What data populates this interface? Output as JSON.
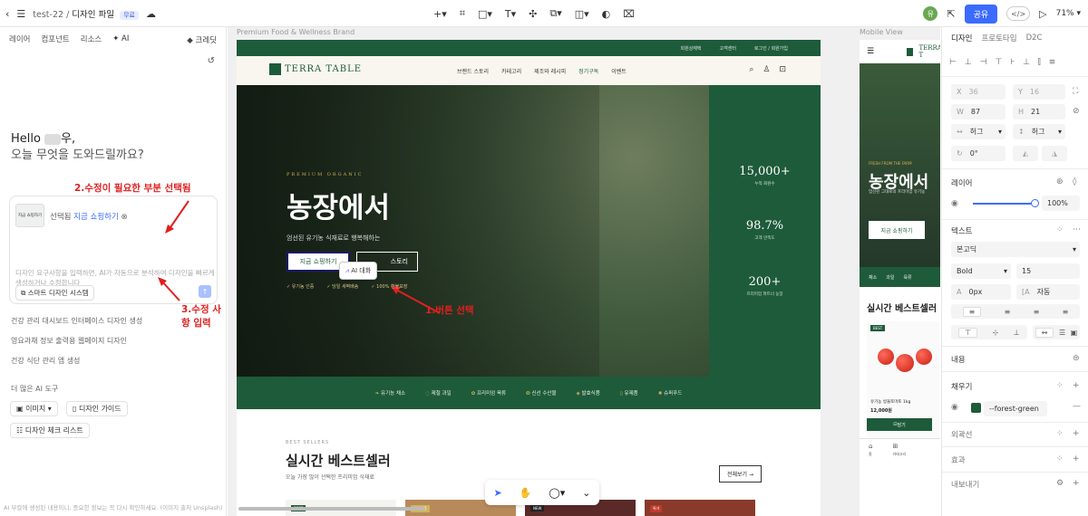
{
  "topbar": {
    "project": "test-22",
    "file": "디자인 파일",
    "badge": "무료",
    "share_label": "공유",
    "code_label": "</>",
    "zoom": "71%",
    "avatar_letter": "유"
  },
  "left": {
    "tabs": [
      "레이어",
      "컴포넌트",
      "리소스",
      "AI"
    ],
    "credit_label": "크레딧",
    "hello": "Hello",
    "hello_suffix": "우,",
    "help_question": "오늘 무엇을 도와드릴까요?",
    "annotation_2": "2.수정이 필요한 부분 선택됨",
    "annotation_3": "3.수정 사항 입력",
    "thumb_text": "지금 쇼핑하기",
    "selected_label": "선택됨",
    "selected_value": "지금 쇼핑하기",
    "input_placeholder": "디자인 요구사항을 입력하면, AI가 자동으로 분석하여 디자인을 빠르게 생성하거나 수정합니다",
    "smart_label": "스마트 디자인 시스템",
    "suggestions": [
      "건강 관리 대시보드 인터페이스 디자인 생성",
      "영요과채 정보 출력용 웹페이지 디자인",
      "건강 식단 관리 앱 생성"
    ],
    "more_tools": "더 많은 AI 도구",
    "chips": [
      "이미지",
      "디자인 가이드",
      "디자인 체크 리스트"
    ],
    "disclaimer": "AI 부칼에 생성된 내용이니, 중요한 정보는 꼭 다시 확인하세요. (이미지 출처 Unsplash)"
  },
  "canvas": {
    "frame_label": "Premium Food & Wellness Brand",
    "mobile_label": "Mobile View",
    "annotation_1": "1.버튼 선택",
    "util_links": [
      "회원상체택",
      "고객센터",
      "로그인 / 회원가입"
    ],
    "brand": "TERRA TABLE",
    "menu": [
      "브랜드 스토리",
      "카테고리",
      "제조와 레시피",
      "정기구독",
      "이벤트"
    ],
    "hero": {
      "eyebrow": "PREMIUM ORGANIC",
      "title": "농장에서",
      "subtitle": "엄선된 유기농 식재료로 행복해하는",
      "primary_btn": "지금 쇼핑하기",
      "secondary_btn": "스토리",
      "ai_popup": "AI 대화",
      "checks": [
        "✓ 유기농 인증",
        "✓ 당일 새벽배송",
        "✓ 100% 환불보장"
      ]
    },
    "stats": [
      {
        "value": "15,000+",
        "label": "누적 회원수"
      },
      {
        "value": "98.7%",
        "label": "고객 만족도"
      },
      {
        "value": "200+",
        "label": "프리미엄 파트너 농장"
      }
    ],
    "categories": [
      "유기농 채소",
      "제철 과일",
      "프리미엄 육류",
      "신선 수산물",
      "발효식품",
      "유제품",
      "슈퍼푸드"
    ],
    "best": {
      "eyebrow": "BEST SELLERS",
      "title": "실시간 베스트셀러",
      "subtitle": "오늘 가장 많이 선택한 프리미엄 식재료",
      "all_btn": "전체보기 →"
    },
    "product_tags": [
      "BEST",
      "인기상품",
      "NEW",
      "특가"
    ],
    "mobile": {
      "brand": "TERRA T",
      "eyebrow": "FRESH FROM THE FARM",
      "title": "농장에서",
      "subline": "엄선된 그대로의 프리미엄 유기농",
      "btn": "지금 쇼핑하기",
      "cats": [
        "채소",
        "과일",
        "육류"
      ],
      "best_title": "실시간 베스트셀러",
      "tag": "BEST",
      "product_name": "유기농 방울토마토 1kg",
      "price": "12,000원",
      "cart_btn": "담기",
      "tab_labels": [
        "홈",
        "카테고리"
      ]
    }
  },
  "right": {
    "tabs": [
      "디자인",
      "프로토타입",
      "D2C"
    ],
    "x_label": "X",
    "x_value": "36",
    "y_label": "Y",
    "y_value": "16",
    "w_label": "W",
    "w_value": "87",
    "h_label": "H",
    "h_value": "21",
    "hug_w": "허그",
    "hug_h": "허그",
    "rotation": "0°",
    "layer_section": "레이어",
    "opacity": "100%",
    "text_section": "텍스트",
    "font_name": "본고딕",
    "font_weight": "Bold",
    "font_size": "15",
    "letter_spacing": "0px",
    "line_height": "자동",
    "content_section": "내용",
    "fill_section": "채우기",
    "fill_value": "--forest-green",
    "stroke_section": "외곽선",
    "effect_section": "효과",
    "export_section": "내보내기"
  },
  "colors": {
    "brand_green": "#1e5b3a",
    "accent_gold": "#d4b25a",
    "share_blue": "#3b6bff",
    "annotation_red": "#e02020"
  }
}
